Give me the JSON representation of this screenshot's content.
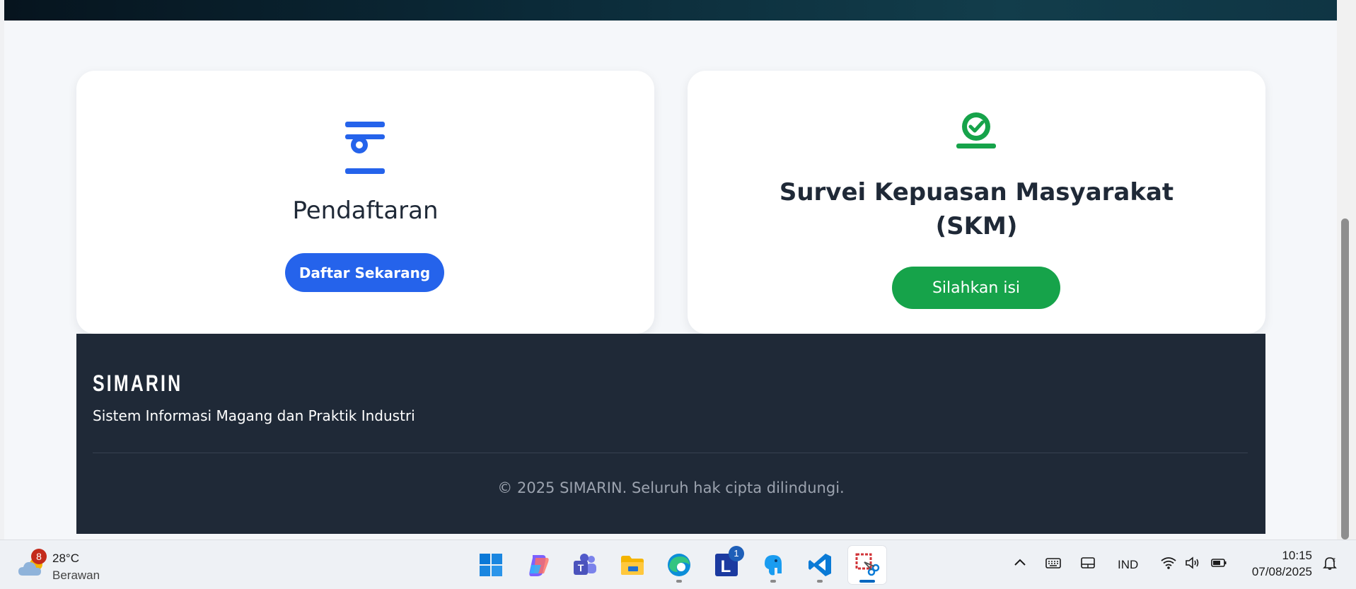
{
  "cards": {
    "registration": {
      "title": "Pendaftaran",
      "button": "Daftar Sekarang",
      "icon": "registration-icon",
      "accent": "#2563eb"
    },
    "skm": {
      "title_line1": "Survei Kepuasan Masyarakat",
      "title_line2": "(SKM)",
      "button": "Silahkan isi",
      "icon": "survey-check-icon",
      "accent": "#16a34a"
    }
  },
  "footer": {
    "brand": "SIMARIN",
    "tagline": "Sistem Informasi Magang dan Praktik Industri",
    "copyright": "© 2025 SIMARIN. Seluruh hak cipta dilindungi.",
    "background": "#1f2937"
  },
  "taskbar": {
    "weather": {
      "badge": "8",
      "temperature": "28°C",
      "condition": "Berawan",
      "icon": "cloud-icon"
    },
    "apps": [
      {
        "name": "windows-start-icon"
      },
      {
        "name": "copilot-icon"
      },
      {
        "name": "teams-icon"
      },
      {
        "name": "file-explorer-icon"
      },
      {
        "name": "edge-icon"
      },
      {
        "name": "l-app-icon",
        "badge": "1"
      },
      {
        "name": "elephant-app-icon"
      },
      {
        "name": "vscode-icon"
      },
      {
        "name": "snipping-tool-icon"
      }
    ],
    "tray": {
      "language": "IND",
      "time": "10:15",
      "date": "07/08/2025"
    }
  }
}
